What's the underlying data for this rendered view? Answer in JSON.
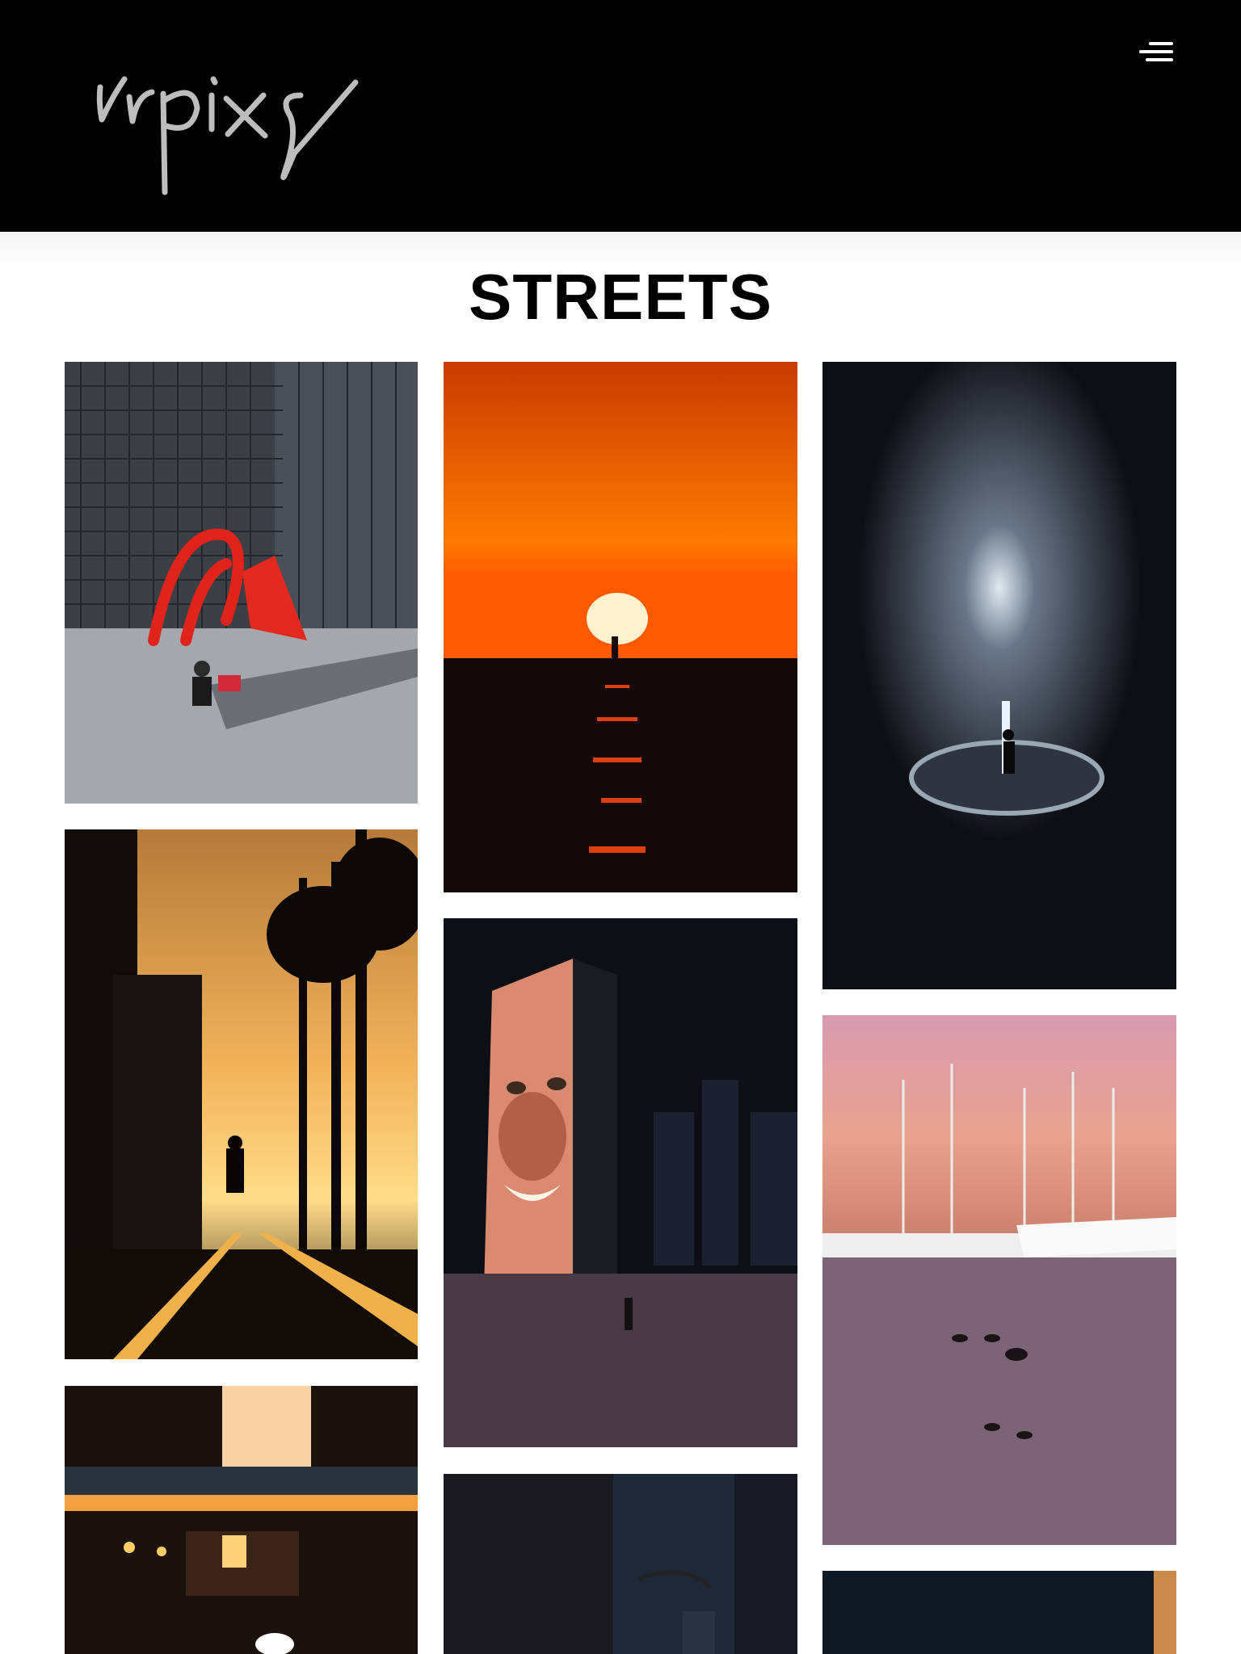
{
  "header": {
    "logo_text": "vrpixs",
    "menu_icon": "hamburger-menu-icon",
    "background": "#000000"
  },
  "page": {
    "title": "STREETS"
  },
  "gallery": {
    "photos": [
      {
        "subject": "red-flamingo-sculpture-skateboarder",
        "dominant_color": "#d8241b"
      },
      {
        "subject": "sunset-over-water-silhouette",
        "dominant_color": "#ff6a00"
      },
      {
        "subject": "night-fountain-with-light",
        "dominant_color": "#0d0f14"
      },
      {
        "subject": "golden-hour-street-palm-trees",
        "dominant_color": "#f0a030"
      },
      {
        "subject": "crown-fountain-face-at-night",
        "dominant_color": "#d98a70"
      },
      {
        "subject": "harbor-boats-and-ducks-at-dusk",
        "dominant_color": "#c98aa0"
      },
      {
        "subject": "elevated-train-at-sunset",
        "dominant_color": "#f3a040"
      },
      {
        "subject": "dark-downtown-street-lamp",
        "dominant_color": "#1e2838"
      },
      {
        "subject": "night-city-building",
        "dominant_color": "#101826"
      }
    ]
  }
}
